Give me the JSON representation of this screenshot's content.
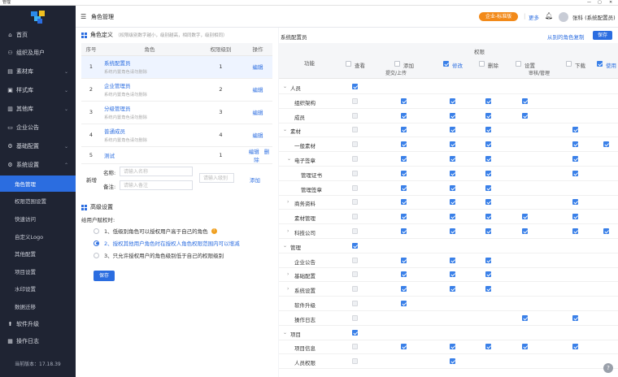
{
  "window": {
    "title": "管理",
    "minimize": "—",
    "maximize": "▢",
    "close": "✕"
  },
  "sidebar": {
    "items": [
      {
        "label": "首页",
        "icon": "home-icon"
      },
      {
        "label": "组织及用户",
        "icon": "users-icon"
      },
      {
        "label": "素材库",
        "icon": "folder-icon"
      },
      {
        "label": "样式库",
        "icon": "style-icon"
      },
      {
        "label": "其他库",
        "icon": "library-icon"
      },
      {
        "label": "企业公告",
        "icon": "notice-icon"
      },
      {
        "label": "基础配置",
        "icon": "config-icon"
      },
      {
        "label": "系统设置",
        "icon": "settings-icon"
      }
    ],
    "sub_items": [
      "角色管理",
      "权限范围设置",
      "快速访问",
      "自定义Logo",
      "其他配置",
      "项目设置",
      "水印设置",
      "数据迁移"
    ],
    "bottom_items": [
      {
        "label": "软件升级",
        "icon": "upgrade-icon"
      },
      {
        "label": "操作日志",
        "icon": "log-icon"
      }
    ],
    "version": "当前版本：17.18.39"
  },
  "header": {
    "page_title": "角色管理",
    "org_badge": "企业-标准版",
    "more": "更多",
    "user": "张科 (系统配置员)"
  },
  "roles": {
    "title": "角色定义",
    "hint": "（权限级别数字越小，级别越高，相同数字，级别相同）",
    "columns": [
      "序号",
      "角色",
      "权限级别",
      "操作"
    ],
    "rows": [
      {
        "no": "1",
        "name": "系统配置员",
        "desc": "系统内置角色请勿删除",
        "level": "1",
        "ops": [
          "编辑"
        ]
      },
      {
        "no": "2",
        "name": "企业管理员",
        "desc": "系统内置角色请勿删除",
        "level": "2",
        "ops": [
          "编辑"
        ]
      },
      {
        "no": "3",
        "name": "分级管理员",
        "desc": "系统内置角色请勿删除",
        "level": "3",
        "ops": [
          "编辑"
        ]
      },
      {
        "no": "4",
        "name": "普通成员",
        "desc": "系统内置角色请勿删除",
        "level": "4",
        "ops": [
          "编辑"
        ]
      },
      {
        "no": "5",
        "name": "测试",
        "desc": "",
        "level": "1",
        "ops": [
          "编辑",
          "删除"
        ]
      }
    ],
    "new_row": {
      "label": "新增",
      "name_label": "名称:",
      "name_placeholder": "请输入名称",
      "remark_label": "备注:",
      "remark_placeholder": "请输入备注",
      "level_placeholder": "请输入级别",
      "add": "添加"
    }
  },
  "advanced": {
    "title": "高级设置",
    "prompt": "给用户赋权时:",
    "options": [
      "1、低级别角色可以授权用户高于自己的角色",
      "2、授权其他用户角色时在授权人角色权限范围内可以增减",
      "3、只允许授权用户的角色级别低于自己的权限级别"
    ],
    "selected": 1,
    "save": "保存"
  },
  "perms": {
    "title": "系统配置员",
    "copy_link": "从别的角色复制",
    "save": "保存",
    "head_function": "功能",
    "head_perm": "权限",
    "columns": [
      "查看",
      "添加",
      "修改",
      "删除",
      "设置",
      "下载",
      "使用"
    ],
    "sub_headers": [
      "提交/上传",
      "审核/管理"
    ],
    "header_checked": [
      false,
      false,
      true,
      false,
      false,
      false,
      true
    ],
    "rows": [
      {
        "name": "人员",
        "level": 0,
        "chev": "expanded",
        "cells": [
          "c"
        ]
      },
      {
        "name": "组织架构",
        "level": 1,
        "chev": "",
        "cells": [
          "d",
          "c",
          "c",
          "c",
          "c"
        ]
      },
      {
        "name": "成员",
        "level": 1,
        "chev": "",
        "cells": [
          "d",
          "c",
          "c",
          "c",
          "c"
        ]
      },
      {
        "name": "素材",
        "level": 0,
        "chev": "expanded",
        "cells": [
          "d",
          "c",
          "c",
          "c",
          "",
          "c"
        ]
      },
      {
        "name": "一般素材",
        "level": 1,
        "chev": "",
        "cells": [
          "d",
          "c",
          "c",
          "c",
          "",
          "c",
          "c"
        ]
      },
      {
        "name": "电子签章",
        "level": 1,
        "chev": "expanded",
        "cells": [
          "d",
          "c",
          "c",
          "c",
          "",
          "c"
        ]
      },
      {
        "name": "管理证书",
        "level": 2,
        "chev": "",
        "cells": [
          "d",
          "c",
          "c",
          "c",
          "",
          "c"
        ]
      },
      {
        "name": "管理签章",
        "level": 2,
        "chev": "",
        "cells": [
          "d",
          "c",
          "c",
          "c"
        ]
      },
      {
        "name": "商务资料",
        "level": 1,
        "chev": "collapsed",
        "cells": [
          "d",
          "c",
          "c",
          "c",
          "",
          "c"
        ]
      },
      {
        "name": "素材管理",
        "level": 1,
        "chev": "",
        "cells": [
          "d",
          "c",
          "c",
          "c",
          "c",
          "c"
        ]
      },
      {
        "name": "科技公司",
        "level": 1,
        "chev": "collapsed",
        "cells": [
          "d",
          "c",
          "c",
          "c",
          "c",
          "c",
          "c"
        ]
      },
      {
        "name": "管理",
        "level": 0,
        "chev": "expanded",
        "cells": [
          "c"
        ]
      },
      {
        "name": "企业公告",
        "level": 1,
        "chev": "",
        "cells": [
          "d",
          "c",
          "c",
          "c"
        ]
      },
      {
        "name": "基础配置",
        "level": 1,
        "chev": "collapsed",
        "cells": [
          "d",
          "c",
          "c",
          "c"
        ]
      },
      {
        "name": "系统设置",
        "level": 1,
        "chev": "collapsed",
        "cells": [
          "d",
          "c",
          "c",
          "c"
        ]
      },
      {
        "name": "软件升级",
        "level": 1,
        "chev": "",
        "cells": [
          "d",
          "c"
        ]
      },
      {
        "name": "操作日志",
        "level": 1,
        "chev": "",
        "cells": [
          "d",
          "",
          "",
          "",
          "c",
          "c"
        ]
      },
      {
        "name": "项目",
        "level": 0,
        "chev": "expanded",
        "cells": [
          "c"
        ]
      },
      {
        "name": "项目信息",
        "level": 1,
        "chev": "",
        "cells": [
          "d",
          "c",
          "c",
          "c",
          "c",
          "c"
        ]
      },
      {
        "name": "人员权限",
        "level": 1,
        "chev": "",
        "cells": [
          "d",
          "",
          "c"
        ]
      }
    ]
  },
  "help": "?",
  "colors": {
    "accent": "#2b6de0",
    "sidebar": "#1f2433",
    "badge": "#f28a1a"
  }
}
